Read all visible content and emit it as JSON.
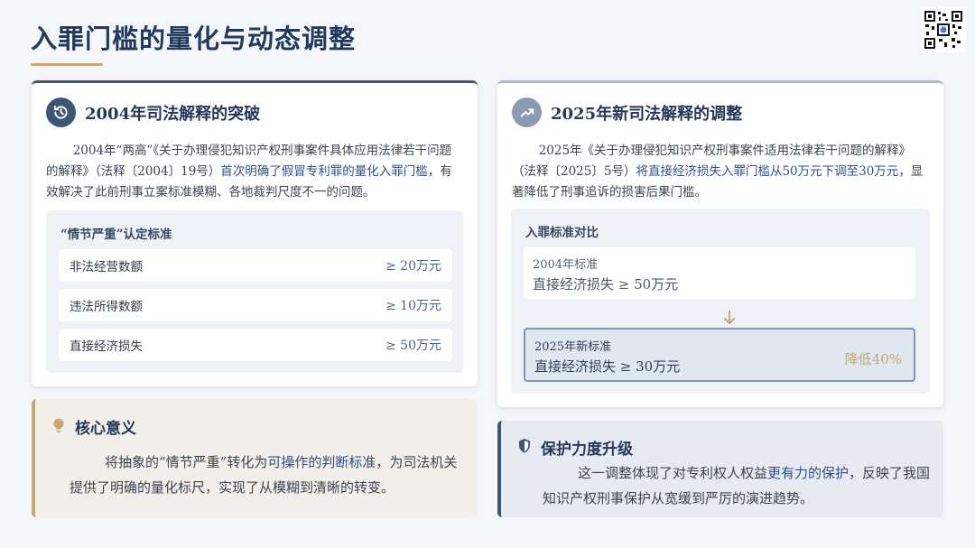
{
  "title": "入罪门槛的量化与动态调整",
  "left_card": {
    "title": "2004年司法解释的突破",
    "para": {
      "part1": "2004年“两高”《关于办理侵犯知识产权刑事案件具体应用法律若干问题的解释》（法释〔2004〕19号）",
      "highlight": "首次明确了假冒专利罪的量化入罪门槛",
      "part2": "，有效解决了此前刑事立案标准模糊、各地裁判尺度不一的问题。"
    },
    "criteria": {
      "title": "“情节严重”认定标准",
      "rows": [
        {
          "label": "非法经营数额",
          "value": "≥ 20万元"
        },
        {
          "label": "违法所得数额",
          "value": "≥ 10万元"
        },
        {
          "label": "直接经济损失",
          "value": "≥ 50万元"
        }
      ]
    }
  },
  "right_card": {
    "title": "2025年新司法解释的调整",
    "para": {
      "part1": "2025年《关于办理侵犯知识产权刑事案件适用法律若干问题的解释》（法释〔2025〕5号）",
      "highlight": "将直接经济损失入罪门槛从50万元下调至30万元",
      "part2": "，显著降低了刑事追诉的损害后果门槛。"
    },
    "comparison": {
      "title": "入罪标准对比",
      "old": {
        "label": "2004年标准",
        "value": "直接经济损失 ≥ 50万元"
      },
      "new": {
        "label": "2025年新标准",
        "value": "直接经济损失 ≥ 30万元",
        "badge": "降低40%"
      }
    }
  },
  "core": {
    "title": "核心意义",
    "part1": "将抽象的“情节严重”转化为",
    "highlight": "可操作的判断标准",
    "part2": "，为司法机关提供了明确的量化标尺，实现了从模糊到清晰的转变。"
  },
  "protect": {
    "title": "保护力度升级",
    "part1": "这一调整体现了对专利权人权益",
    "highlight": "更有力的保护",
    "part2": "，反映了我国知识产权刑事保护从宽缓到严厉的演进趋势。"
  },
  "colors": {
    "navy": "#3e5675",
    "gold": "#c9a977",
    "highlight": "#2f4f86"
  }
}
